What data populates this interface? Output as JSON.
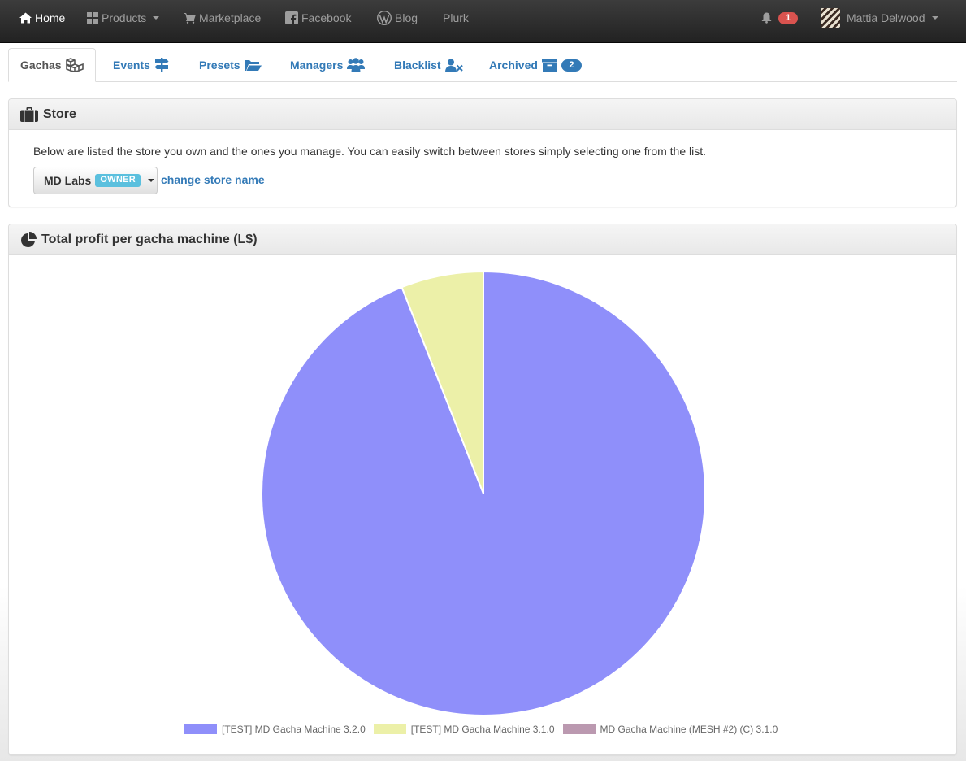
{
  "navbar": {
    "home": "Home",
    "products": "Products",
    "marketplace": "Marketplace",
    "facebook": "Facebook",
    "blog": "Blog",
    "plurk": "Plurk",
    "notifications_count": "1",
    "user_name": "Mattia Delwood"
  },
  "tabs": {
    "gachas": "Gachas",
    "events": "Events",
    "presets": "Presets",
    "managers": "Managers",
    "blacklist": "Blacklist",
    "archived": "Archived",
    "archived_count": "2"
  },
  "store_panel": {
    "title": "Store",
    "description": "Below are listed the store you own and the ones you manage. You can easily switch between stores simply selecting one from the list.",
    "selected_store": "MD Labs",
    "owner_label": "OWNER",
    "change_link": "change store name"
  },
  "chart_panel": {
    "title": "Total profit per gacha machine (L$)"
  },
  "colors": {
    "accent_link": "#337ab7",
    "notification_badge": "#d9534f",
    "owner_label": "#5bc0de"
  },
  "chart_data": {
    "type": "pie",
    "title": "Total profit per gacha machine (L$)",
    "series": [
      {
        "name": "[TEST] MD Gacha Machine 3.2.0",
        "value": 94,
        "color": "#8f8ffa"
      },
      {
        "name": "[TEST] MD Gacha Machine 3.1.0",
        "value": 6,
        "color": "#ecf0a8"
      },
      {
        "name": "MD Gacha Machine (MESH #2) (C) 3.1.0",
        "value": 0,
        "color": "#bb99b0"
      }
    ],
    "legend_position": "bottom"
  }
}
